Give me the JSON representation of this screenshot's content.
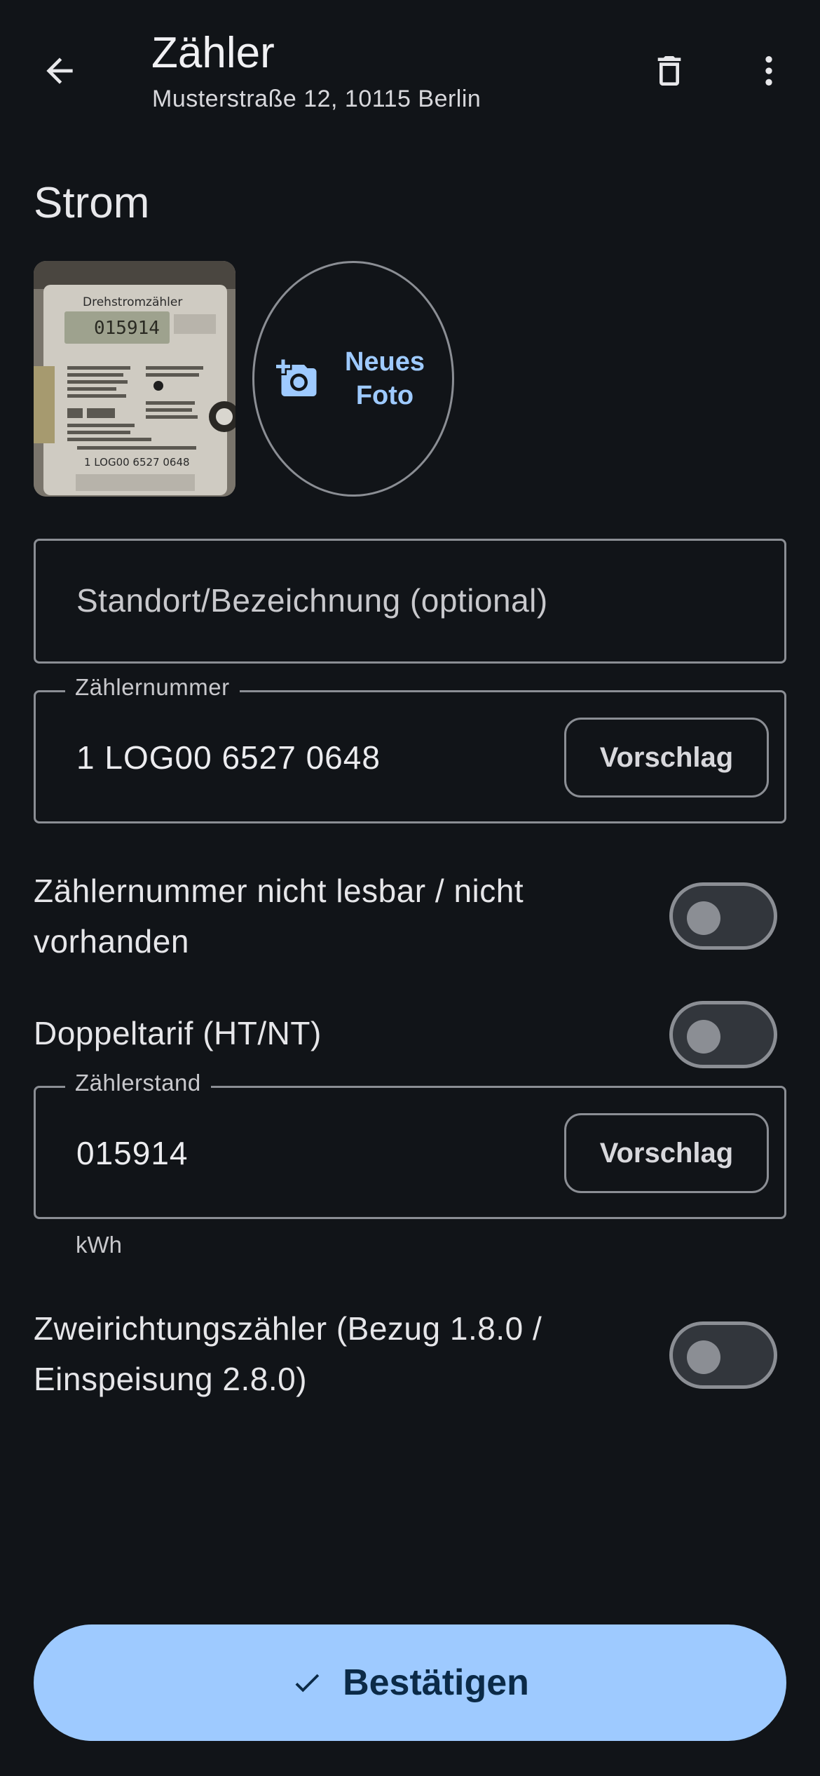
{
  "appbar": {
    "title": "Zähler",
    "subtitle": "Musterstraße 12, 10115 Berlin",
    "icons": {
      "back": "arrow-back-icon",
      "delete": "delete-icon",
      "more": "more-vert-icon"
    }
  },
  "section": {
    "title": "Strom"
  },
  "photo": {
    "thumbnail_texts": {
      "header": "Drehstromzähler",
      "display": "015914",
      "number": "1 LOG00 6527 0648"
    },
    "new_photo_label": "Neues Foto",
    "new_photo_icon": "add-a-photo-icon"
  },
  "fields": {
    "location": {
      "placeholder": "Standort/Bezeichnung (optional)"
    },
    "meter_number": {
      "label": "Zählernummer",
      "value": "1 LOG00 6527 0648",
      "suggest_label": "Vorschlag"
    },
    "reading": {
      "label": "Zählerstand",
      "value": "015914",
      "suggest_label": "Vorschlag",
      "unit": "kWh"
    }
  },
  "switches": {
    "unreadable": {
      "label": "Zählernummer nicht lesbar / nicht vorhanden",
      "on": false
    },
    "dual_tariff": {
      "label": "Doppeltarif (HT/NT)",
      "on": false
    },
    "bidirectional": {
      "label": "Zweirichtungszähler (Bezug 1.8.0 / Einspeisung 2.8.0)",
      "on": false
    }
  },
  "confirm": {
    "label": "Bestätigen",
    "icon": "check-icon"
  },
  "colors": {
    "background": "#111418",
    "accent": "#9ecaff",
    "on_accent": "#0b2a47",
    "outline": "#8b8e94"
  }
}
